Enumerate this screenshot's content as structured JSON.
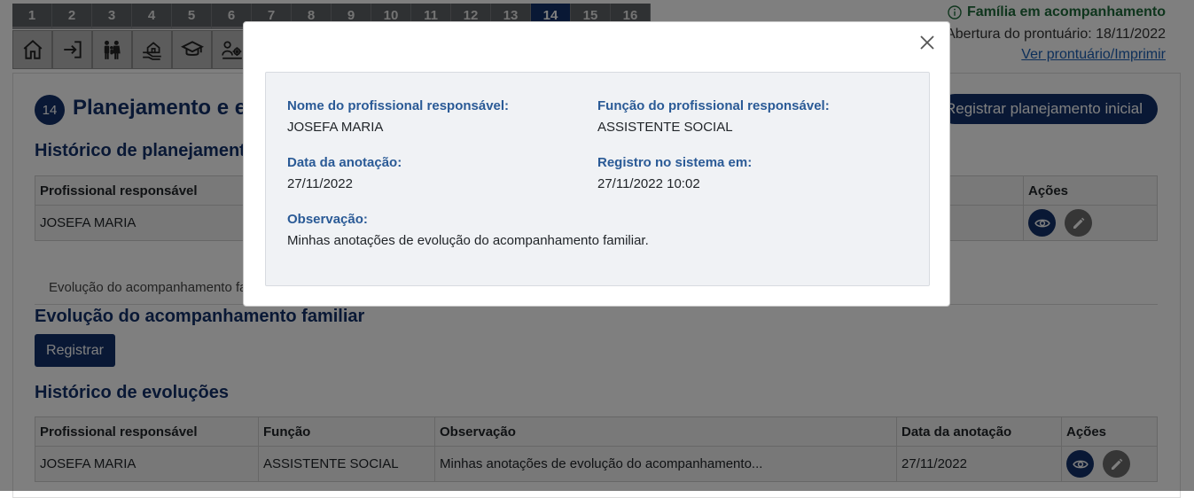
{
  "steps": {
    "tabs": [
      "1",
      "2",
      "3",
      "4",
      "5",
      "6",
      "7",
      "8",
      "9",
      "10",
      "11",
      "12",
      "13",
      "14",
      "15",
      "16"
    ],
    "active": "14",
    "icons": [
      "home-icon",
      "sign-in-icon",
      "family-icon",
      "house-hands-icon",
      "graduation-cap-icon",
      "people-gear-icon"
    ]
  },
  "header": {
    "status": "Família em acompanhamento",
    "abertura": "Abertura do prontuário: 18/11/2022",
    "ver_link": "Ver prontuário/Imprimir"
  },
  "section": {
    "number": "14",
    "title": "Planejamento e evolução do acompanhamento familiar",
    "register_initial_btn": "Registrar planejamento inicial",
    "history_planning_title": "Histórico de planejamentos",
    "planning_table": {
      "headers": [
        "Profissional responsável",
        "Ações"
      ],
      "rows": [
        [
          "JOSEFA MARIA"
        ]
      ]
    },
    "tab_label": "Evolução do acompanhamento familiar",
    "evolution_title": "Evolução do acompanhamento familiar",
    "register_btn": "Registrar",
    "history_evolution_title": "Histórico de evoluções",
    "evolution_table": {
      "headers": [
        "Profissional responsável",
        "Função",
        "Observação",
        "Data da anotação",
        "Ações"
      ],
      "rows": [
        [
          "JOSEFA MARIA",
          "ASSISTENTE SOCIAL",
          "Minhas anotações de evolução do acompanhamento...",
          "27/11/2022"
        ]
      ]
    }
  },
  "modal": {
    "nome_label": "Nome do profissional responsável:",
    "nome_value": "JOSEFA MARIA",
    "funcao_label": "Função do profissional responsável:",
    "funcao_value": "ASSISTENTE SOCIAL",
    "data_label": "Data da anotação:",
    "data_value": "27/11/2022",
    "registro_label": "Registro no sistema em:",
    "registro_value": "27/11/2022 10:02",
    "obs_label": "Observação:",
    "obs_value": "Minhas anotações de evolução do acompanhamento familiar."
  },
  "colors": {
    "primary": "#13316a",
    "status_green": "#1e6b3a",
    "label_blue": "#2a5a96"
  }
}
